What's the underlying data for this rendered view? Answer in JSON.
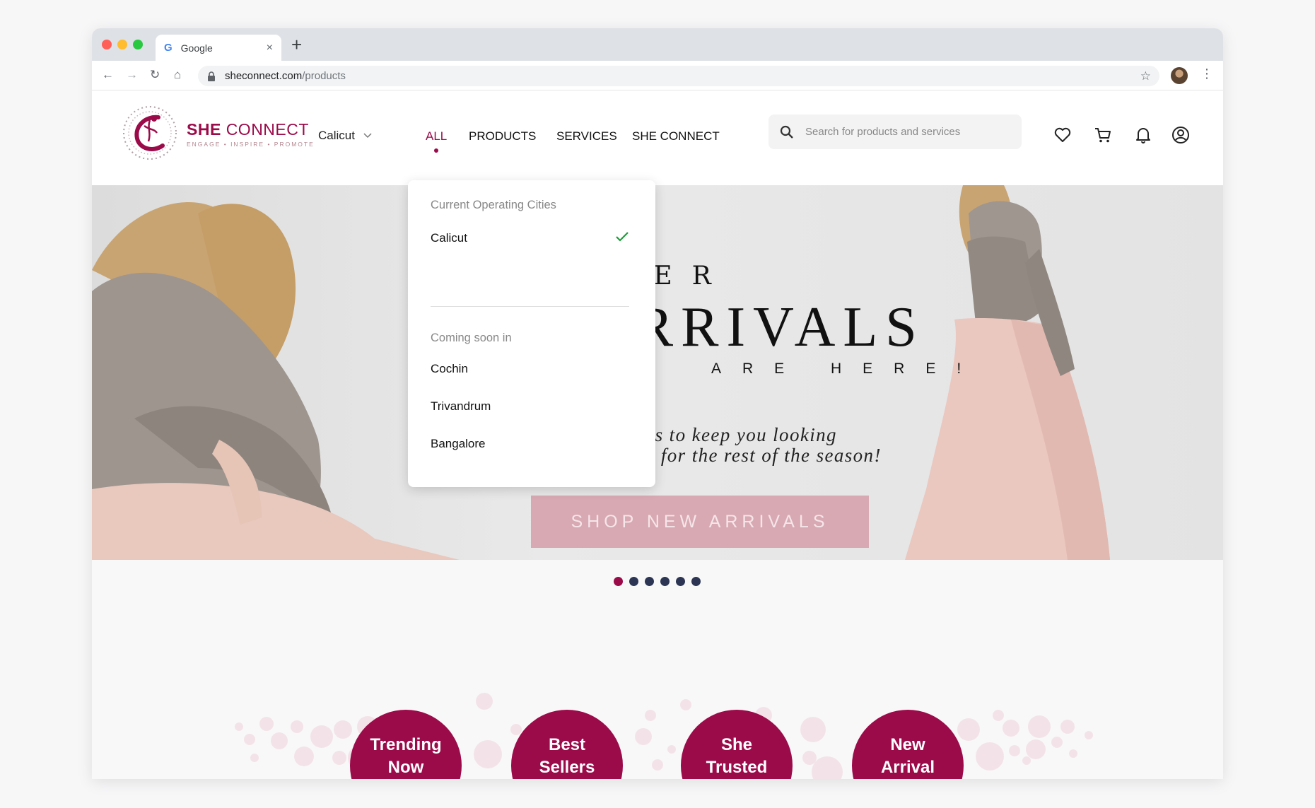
{
  "browser": {
    "tab_title": "Google",
    "tab_close": "×",
    "new_tab": "+",
    "url_domain": "sheconnect.com",
    "url_path": "/products"
  },
  "header": {
    "brand_she": "SHE",
    "brand_connect": "CONNECT",
    "brand_tagline": "ENGAGE • INSPIRE • PROMOTE",
    "city": "Calicut",
    "menu": [
      "ALL",
      "PRODUCTS",
      "SERVICES",
      "SHE CONNECT"
    ],
    "search_placeholder": "Search for products and services"
  },
  "hero": {
    "line1": "MBER",
    "line2": "ARRIVALS",
    "line3": "ARE HERE!",
    "sub1": "ewest styles to keep you looking",
    "sub2": "cute and warm for the rest of the season!",
    "cta": "SHOP NEW ARRIVALS",
    "slides_total": 6,
    "slide_active": 1
  },
  "categories": [
    {
      "line1": "Trending",
      "line2": "Now"
    },
    {
      "line1": "Best",
      "line2": "Sellers"
    },
    {
      "line1": "She",
      "line2": "Trusted"
    },
    {
      "line1": "New",
      "line2": "Arrival"
    }
  ],
  "city_dropdown": {
    "current_heading": "Current Operating Cities",
    "current": [
      "Calicut"
    ],
    "selected": "Calicut",
    "soon_heading": "Coming soon in",
    "soon": [
      "Cochin",
      "Trivandrum",
      "Bangalore"
    ]
  },
  "colors": {
    "brand": "#9b0b4a",
    "dot": "#2c3654",
    "cta_bg": "#d8a9b2",
    "check": "#1e9b3c"
  }
}
